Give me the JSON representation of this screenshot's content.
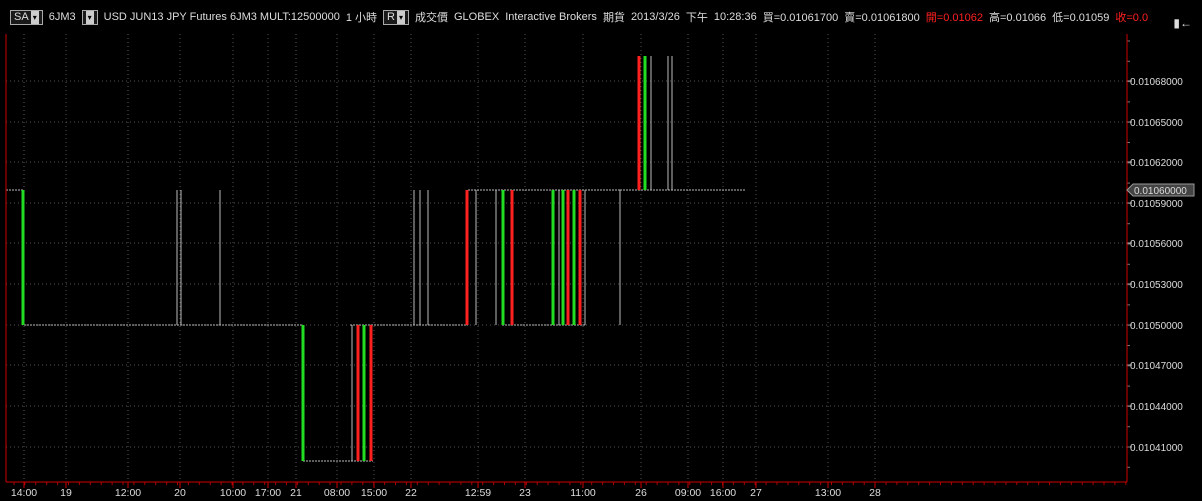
{
  "header": {
    "mode_button": "SA",
    "symbol": "6JM3",
    "contract_desc": "USD JUN13 JPY Futures 6JM3 MULT:12500000",
    "interval": "1 小時",
    "price_type_button": "R",
    "price_type": "成交價",
    "exchange": "GLOBEX",
    "broker": "Interactive Brokers",
    "instrument_type": "期貨",
    "date": "2013/3/26",
    "ampm": "下午",
    "time": "10:28:36",
    "bid": "買=0.01061700",
    "ask": "賣=0.01061800",
    "open": "開=0.01062",
    "high": "高=0.01066",
    "low": "低=0.01059",
    "close": "收=0.0"
  },
  "toolbar": {
    "side_icon": "expand-panel-icon"
  },
  "last_price_label": "0.01060000",
  "colors": {
    "up": "#22dd22",
    "down": "#ff2020",
    "grid": "#555555",
    "frame": "#cc0000",
    "neutral": "#bbbbbb"
  },
  "chart_data": {
    "type": "bar",
    "y_ticks": [
      "0.01068000",
      "0.01065000",
      "0.01062000",
      "0.01059000",
      "0.01056000",
      "0.01053000",
      "0.01050000",
      "0.01047000",
      "0.01044000",
      "0.01041000"
    ],
    "x_ticks": [
      "14:00",
      "19",
      "12:00",
      "20",
      "10:00",
      "17:00",
      "21",
      "08:00",
      "15:00",
      "22",
      "12:59",
      "23",
      "11:00",
      "26",
      "09:00",
      "16:00",
      "27",
      "13:00",
      "28"
    ],
    "ylim": [
      0.0104,
      0.0107
    ],
    "last_price": 0.0106,
    "grid": true
  }
}
